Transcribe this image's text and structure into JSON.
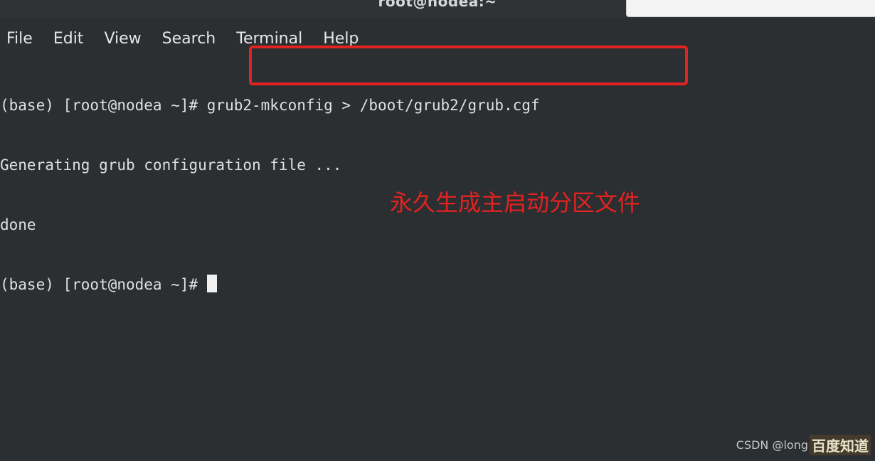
{
  "window": {
    "title": "root@nodea:~"
  },
  "menu": {
    "items": [
      "File",
      "Edit",
      "View",
      "Search",
      "Terminal",
      "Help"
    ]
  },
  "terminal": {
    "lines": [
      "(base) [root@nodea ~]# grub2-mkconfig > /boot/grub2/grub.cgf",
      "Generating grub configuration file ...",
      "done",
      "(base) [root@nodea ~]# "
    ]
  },
  "annotation": {
    "text": "永久生成主启动分区文件",
    "color": "#e32222"
  },
  "watermark": {
    "csdn": "CSDN @long",
    "baidu": "百度知道"
  },
  "colors": {
    "background": "#2b2f31",
    "text": "#e0e0e0",
    "highlight": "#e32222"
  }
}
